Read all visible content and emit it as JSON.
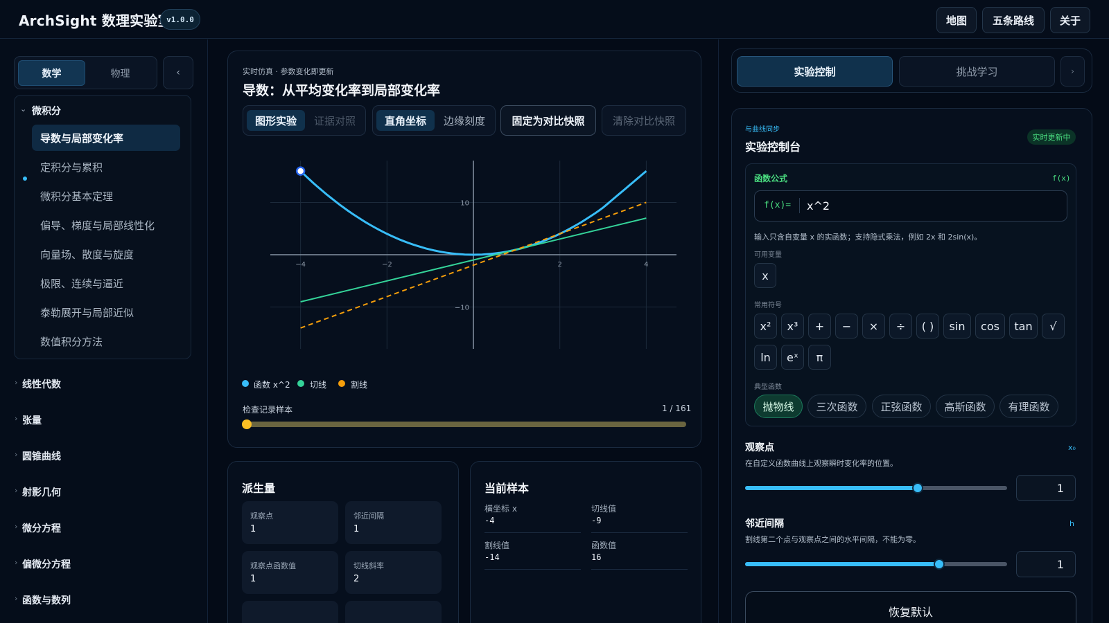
{
  "header": {
    "title": "ArchSight 数理实验室",
    "version": "v1.0.0",
    "buttons": [
      "地图",
      "五条路线",
      "关于"
    ]
  },
  "sidebar": {
    "tabs": [
      {
        "label": "数学",
        "active": true
      },
      {
        "label": "物理",
        "active": false
      }
    ],
    "collapse_icon": "chevron-left-icon",
    "open_group": {
      "title": "微积分",
      "items": [
        {
          "label": "导数与局部变化率",
          "active": true
        },
        {
          "label": "定积分与累积"
        },
        {
          "label": "微积分基本定理"
        },
        {
          "label": "偏导、梯度与局部线性化"
        },
        {
          "label": "向量场、散度与旋度"
        },
        {
          "label": "极限、连续与逼近"
        },
        {
          "label": "泰勒展开与局部近似"
        },
        {
          "label": "数值积分方法"
        }
      ]
    },
    "sections": [
      "线性代数",
      "张量",
      "圆锥曲线",
      "射影几何",
      "微分方程",
      "偏微分方程",
      "函数与数列"
    ]
  },
  "main": {
    "kicker": "实时仿真 · 参数变化即更新",
    "title": "导数：从平均变化率到局部变化率",
    "toolbar": {
      "view_tabs": [
        "图形实验",
        "证据对照"
      ],
      "coord_tabs": [
        "直角坐标",
        "边缘刻度"
      ],
      "pin_label": "固定为对比快照",
      "clear_label": "清除对比快照"
    },
    "legend": [
      "函数 x^2",
      "切线",
      "割线"
    ],
    "sample": {
      "label": "检查记录样本",
      "counter": "1 / 161",
      "value": 0
    }
  },
  "chart_data": {
    "type": "line",
    "xlim": [
      -4.7,
      4.7
    ],
    "ylim": [
      -18,
      18
    ],
    "xticks": [
      -4,
      -2,
      2,
      4
    ],
    "yticks": [
      10,
      -10
    ],
    "grid": true,
    "series": [
      {
        "name": "函数 x^2",
        "color": "#38bdf8",
        "x": [
          -4,
          -3,
          -2,
          -1,
          0,
          1,
          2,
          3,
          4
        ],
        "y": [
          16,
          9,
          4,
          1,
          0,
          1,
          4,
          9,
          16
        ]
      },
      {
        "name": "切线",
        "color": "#34d399",
        "x": [
          -4,
          4
        ],
        "y": [
          -9,
          7
        ]
      },
      {
        "name": "割线",
        "color": "#f59e0b",
        "dashed": true,
        "x": [
          -4,
          4
        ],
        "y": [
          -14,
          10
        ]
      }
    ],
    "marker": {
      "x": -4,
      "y": 16
    }
  },
  "derived": {
    "title": "派生量",
    "stats": [
      {
        "label": "观察点",
        "value": "1"
      },
      {
        "label": "邻近间隔",
        "value": "1"
      },
      {
        "label": "观察点函数值",
        "value": "1"
      },
      {
        "label": "切线斜率",
        "value": "2"
      }
    ]
  },
  "current": {
    "title": "当前样本",
    "rows": [
      {
        "label": "横坐标 x",
        "value": "-4"
      },
      {
        "label": "切线值",
        "value": "-9"
      },
      {
        "label": "割线值",
        "value": "-14"
      },
      {
        "label": "函数值",
        "value": "16"
      }
    ]
  },
  "right": {
    "tabs": [
      "实验控制",
      "挑战学习"
    ],
    "next_icon": "chevron-right-icon",
    "sync_label": "与曲线同步",
    "panel_title": "实验控制台",
    "live_badge": "实时更新中",
    "formula": {
      "title": "函数公式",
      "tag": "f(x)",
      "prefix": "f(x)=",
      "value": "x^2",
      "hint": "输入只含自变量 x 的实函数；支持隐式乘法，例如 2x 和 2sin(x)。",
      "vars_label": "可用变量",
      "vars": [
        "x"
      ],
      "symbols_label": "常用符号",
      "symbols": [
        "x²",
        "x³",
        "+",
        "−",
        "×",
        "÷",
        "( )",
        "sin",
        "cos",
        "tan",
        "√",
        "ln",
        "eˣ",
        "π"
      ],
      "presets_label": "典型函数",
      "presets": [
        "抛物线",
        "三次函数",
        "正弦函数",
        "高斯函数",
        "有理函数"
      ]
    },
    "observe": {
      "title": "观察点",
      "symbol": "x₀",
      "desc": "在自定义函数曲线上观察瞬时变化率的位置。",
      "value": "1",
      "slider_fraction": 0.66
    },
    "interval": {
      "title": "邻近间隔",
      "symbol": "h",
      "desc": "割线第二个点与观察点之间的水平间隔，不能为零。",
      "value": "1",
      "slider_fraction": 0.74
    },
    "reset_label": "恢复默认"
  }
}
